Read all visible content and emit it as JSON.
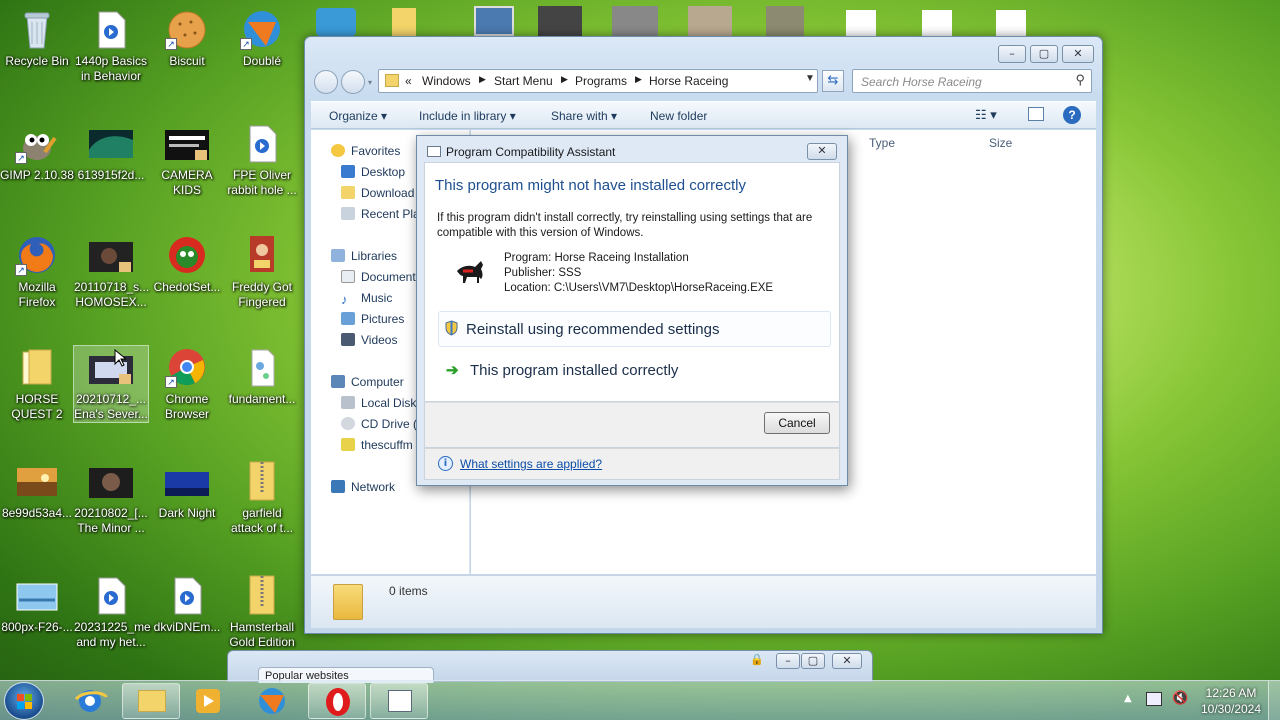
{
  "desktop_icons": [
    {
      "id": "recycle",
      "label": "Recycle Bin",
      "icon": "recycle-bin-icon"
    },
    {
      "id": "basics",
      "label": "1440p Basics in Behavior",
      "icon": "media-file-icon"
    },
    {
      "id": "biscuit",
      "label": "Biscuit",
      "icon": "cookie-icon"
    },
    {
      "id": "doubl",
      "label": "Doublé",
      "icon": "doublé-app-icon"
    },
    {
      "id": "gimp",
      "label": "GIMP 2.10.38",
      "icon": "gimp-icon"
    },
    {
      "id": "aurora",
      "label": "613915f2d...",
      "icon": "image-thumbnail-icon"
    },
    {
      "id": "camera",
      "label": "CAMERA KIDS",
      "icon": "video-thumbnail-icon"
    },
    {
      "id": "fpe",
      "label": "FPE Oliver rabbit hole ...",
      "icon": "media-file-icon"
    },
    {
      "id": "firefox",
      "label": "Mozilla Firefox",
      "icon": "firefox-icon"
    },
    {
      "id": "homosex",
      "label": "20110718_s... HOMOSEX...",
      "icon": "video-thumbnail-icon"
    },
    {
      "id": "chedot",
      "label": "ChedotSet...",
      "icon": "chedot-icon"
    },
    {
      "id": "freddy",
      "label": "Freddy Got Fingered",
      "icon": "movie-poster-icon"
    },
    {
      "id": "horsequest",
      "label": "HORSE QUEST 2",
      "icon": "folder-icon"
    },
    {
      "id": "ena",
      "label": "20210712_... Ena's Sever...",
      "icon": "video-thumbnail-icon"
    },
    {
      "id": "chrome",
      "label": "Chrome Browser",
      "icon": "chrome-icon"
    },
    {
      "id": "fundament",
      "label": "fundament...",
      "icon": "text-file-icon"
    },
    {
      "id": "sunset",
      "label": "8e99d53a4...",
      "icon": "image-thumbnail-icon"
    },
    {
      "id": "minor",
      "label": "20210802_[... The Minor ...",
      "icon": "video-thumbnail-icon"
    },
    {
      "id": "darknight",
      "label": "Dark Night",
      "icon": "image-thumbnail-icon"
    },
    {
      "id": "garfield",
      "label": "garfield attack of t...",
      "icon": "zip-folder-icon"
    },
    {
      "id": "f26",
      "label": "800px-F26-...",
      "icon": "image-thumbnail-icon"
    },
    {
      "id": "met",
      "label": "20231225_me and my het...",
      "icon": "media-file-icon"
    },
    {
      "id": "dkvi",
      "label": "dkviDNEm...",
      "icon": "media-file-icon"
    },
    {
      "id": "hamster",
      "label": "Hamsterball Gold Edition",
      "icon": "zip-folder-icon"
    }
  ],
  "explorer": {
    "breadcrumb": [
      "«",
      "Windows",
      "Start Menu",
      "Programs",
      "Horse Raceing"
    ],
    "search_placeholder": "Search Horse Raceing",
    "toolbar": {
      "organize": "Organize",
      "include": "Include in library",
      "share": "Share with",
      "new_folder": "New folder"
    },
    "nav": {
      "favorites": "Favorites",
      "desktop": "Desktop",
      "downloads": "Download",
      "recent": "Recent Pla",
      "libraries": "Libraries",
      "documents": "Document",
      "music": "Music",
      "pictures": "Pictures",
      "videos": "Videos",
      "computer": "Computer",
      "local_disk": "Local Disk",
      "cd_drive": "CD Drive (",
      "thescuff": "thescuffm",
      "network": "Network"
    },
    "columns": {
      "type": "Type",
      "size": "Size"
    },
    "status": "0 items"
  },
  "dialog": {
    "title": "Program Compatibility Assistant",
    "heading": "This program might not have installed correctly",
    "message": "If this program didn't install correctly, try reinstalling using settings that are compatible with this version of Windows.",
    "program": "Program: Horse Raceing Installation",
    "publisher": "Publisher: SSS",
    "location": "Location: C:\\Users\\VM7\\Desktop\\HorseRaceing.EXE",
    "option_reinstall": "Reinstall using recommended settings",
    "option_ok": "This program installed correctly",
    "cancel": "Cancel",
    "link": "What settings are applied?"
  },
  "background_window": {
    "tab": "Popular websites"
  },
  "clock": {
    "time": "12:26 AM",
    "date": "10/30/2024"
  },
  "colors": {
    "accent": "#1f5fa6",
    "heading": "#1d4f91",
    "link": "#0b4da8"
  }
}
